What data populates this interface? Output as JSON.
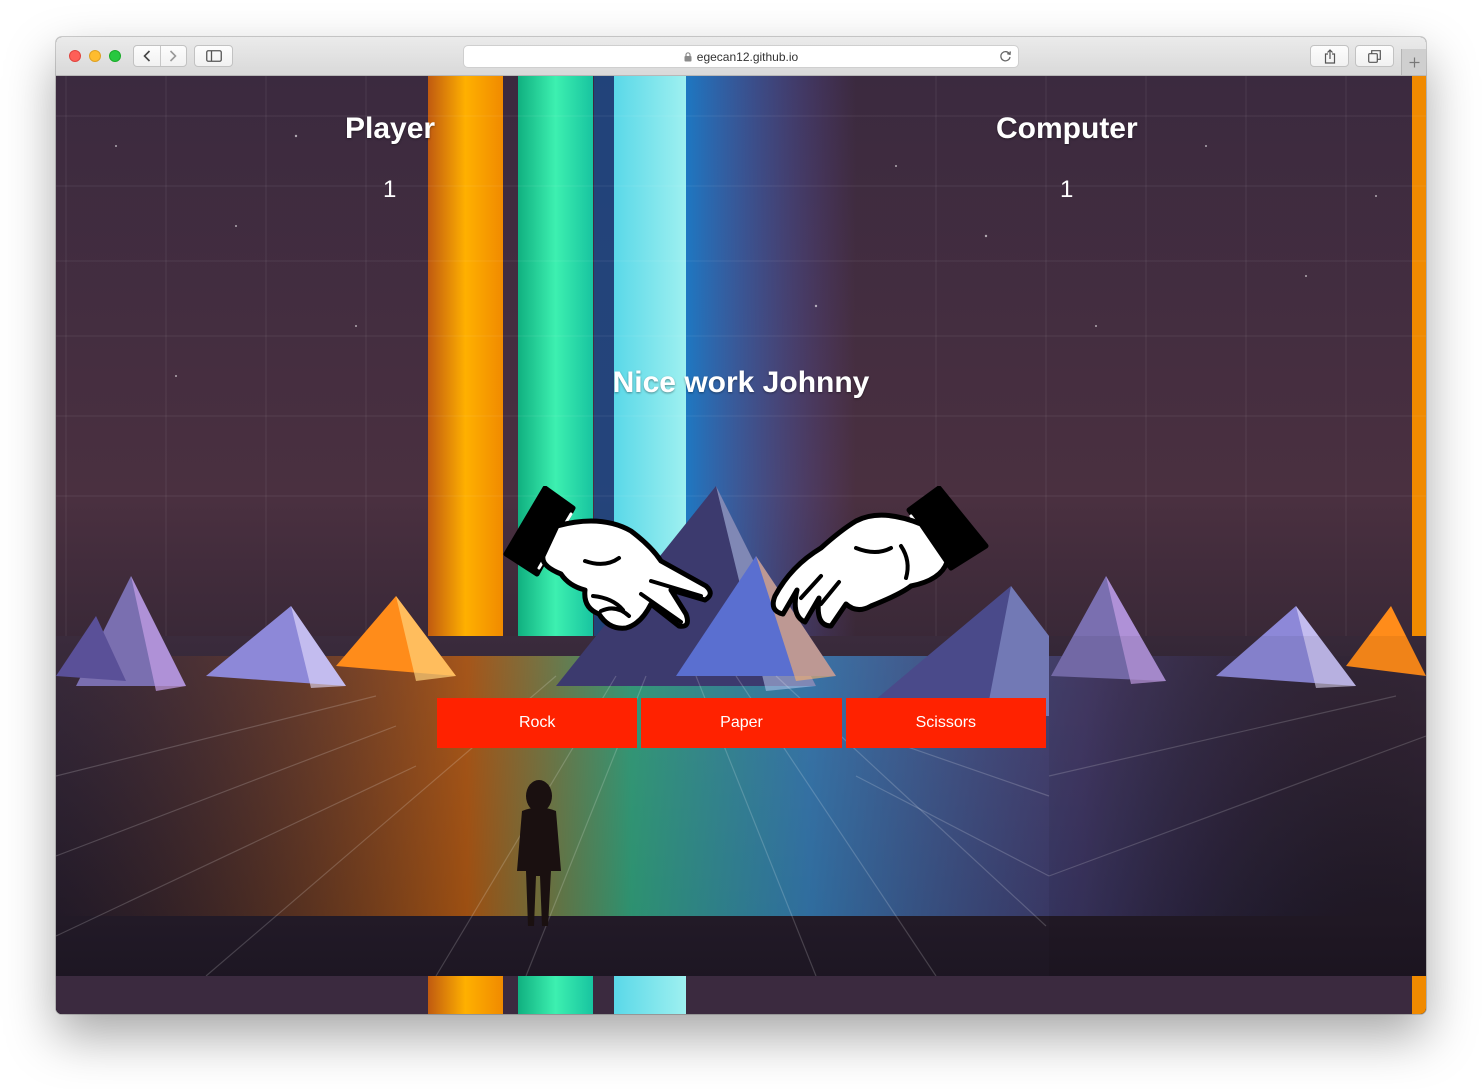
{
  "browser": {
    "url": "egecan12.github.io"
  },
  "game": {
    "player_label": "Player",
    "computer_label": "Computer",
    "player_score": "1",
    "computer_score": "1",
    "message": "Nice work Johnny",
    "player_hand": "scissors-hand",
    "computer_hand": "paper-hand",
    "choices": [
      "Rock",
      "Paper",
      "Scissors"
    ]
  },
  "colors": {
    "button_bg": "#ff2200",
    "text": "#ffffff"
  }
}
